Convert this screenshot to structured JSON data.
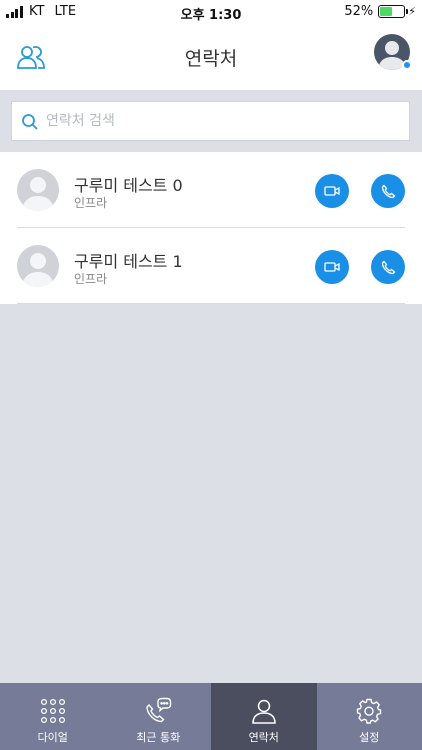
{
  "status_bar": {
    "carrier": "KT",
    "network": "LTE",
    "time": "오후 1:30",
    "battery_percent": "52%",
    "battery_level": 0.52
  },
  "header": {
    "title": "연락처",
    "left_icon": "group-users-icon",
    "right_icon": "profile-avatar"
  },
  "search": {
    "placeholder": "연락처 검색",
    "value": ""
  },
  "contacts": [
    {
      "name": "구루미 테스트 0",
      "org": "인프라"
    },
    {
      "name": "구루미 테스트 1",
      "org": "인프라"
    }
  ],
  "tabs": [
    {
      "label": "다이얼",
      "icon": "dialpad-icon",
      "active": false
    },
    {
      "label": "최근 통화",
      "icon": "recent-calls-icon",
      "active": false
    },
    {
      "label": "연락처",
      "icon": "contacts-icon",
      "active": true
    },
    {
      "label": "설정",
      "icon": "gear-icon",
      "active": false
    }
  ],
  "colors": {
    "accent_blue": "#1a8fe6",
    "tab_bar": "#767b97",
    "tab_active": "#4b4e5e",
    "background": "#dcdfe5",
    "battery_green": "#4cd964"
  }
}
